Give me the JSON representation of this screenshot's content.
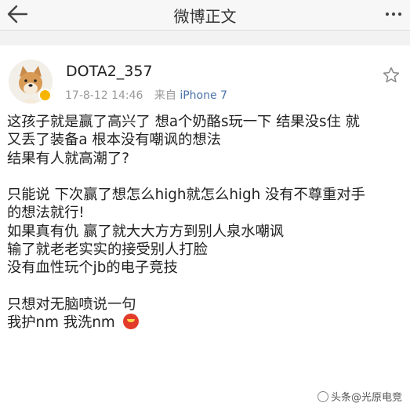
{
  "navbar": {
    "back_icon": "back-arrow-icon",
    "title": "微博正文",
    "more_icon": "more-dots-icon"
  },
  "post": {
    "author": "DOTA2_357",
    "timestamp": "17-8-12 14:46",
    "source_prefix": "来自",
    "device": "iPhone 7",
    "verified_badge_color": "#f7b500",
    "follow_icon": "star-icon",
    "lines": [
      "这孩子就是赢了高兴了 想a个奶酪s玩一下 结果没s住 就",
      "又丢了装备a 根本没有嘲讽的想法",
      "结果有人就高潮了?",
      "",
      "只能说 下次赢了想怎么high就怎么high 没有不尊重对手",
      "的想法就行!",
      "如果真有仇 赢了就大大方方到别人泉水嘲讽",
      "输了就老老实实的接受别人打脸",
      "没有血性玩个jb的电子竞技",
      "",
      "只想对无脑喷说一句",
      "我护nm 我洗nm"
    ],
    "emoji_icon": "angry-face-emoji-icon"
  },
  "watermark": {
    "text": "头条@光原电竞"
  }
}
